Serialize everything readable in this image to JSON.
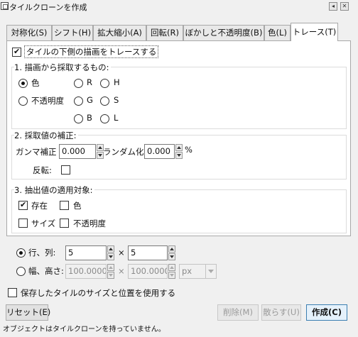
{
  "window": {
    "title": "タイルクローンを作成",
    "buttons": [
      "◂",
      "✕"
    ]
  },
  "tabs": [
    {
      "label": "対称化(S)",
      "active": false
    },
    {
      "label": "シフト(H)",
      "active": false
    },
    {
      "label": "拡大縮小(A)",
      "active": false
    },
    {
      "label": "回転(R)",
      "active": false
    },
    {
      "label": "ぼかしと不透明度(B)",
      "active": false
    },
    {
      "label": "色(L)",
      "active": false
    },
    {
      "label": "トレース(T)",
      "active": true
    }
  ],
  "trace": {
    "trace_checkbox_label": "タイルの下側の描画をトレースする",
    "trace_checked": true,
    "pick": {
      "title": "1. 描画から採取するもの:",
      "options": [
        "色",
        "不透明度",
        "R",
        "G",
        "B",
        "H",
        "S",
        "L"
      ],
      "selected": "色"
    },
    "tweak": {
      "title": "2. 採取値の補正:",
      "gamma_label": "ガンマ補正",
      "gamma_value": "0.000",
      "random_label": "ランダム化:",
      "random_value": "0.000",
      "random_unit": "%",
      "invert_label": "反転:",
      "invert_checked": false
    },
    "apply": {
      "title": "3. 抽出値の適用対象:",
      "presence_label": "存在",
      "presence_checked": true,
      "color_label": "色",
      "color_checked": false,
      "size_label": "サイズ",
      "size_checked": false,
      "opacity_label": "不透明度",
      "opacity_checked": false
    }
  },
  "layout_mode": {
    "rows_cols_label": "行、列:",
    "rows_value": "5",
    "cols_value": "5",
    "times": "×",
    "width_height_label": "幅、高さ:",
    "width_value": "100.0000",
    "height_value": "100.0000",
    "unit": "px",
    "selected": "rows_cols"
  },
  "use_saved_label": "保存したタイルのサイズと位置を使用する",
  "use_saved_checked": false,
  "buttons": {
    "reset": "リセット(E)",
    "remove": "削除(M)",
    "unclump": "散らす(U)",
    "create": "作成(C)"
  },
  "status": "オブジェクトはタイルクローンを持っていません。"
}
